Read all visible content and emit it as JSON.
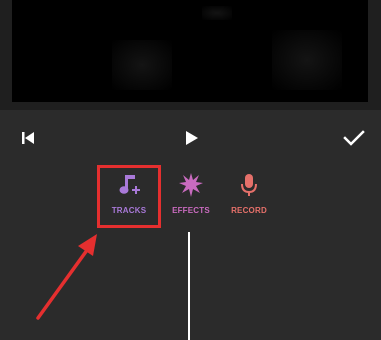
{
  "controls": {
    "skip_back_icon": "skip-to-start-icon",
    "play_icon": "play-icon",
    "done_icon": "checkmark-icon"
  },
  "tabs": [
    {
      "label": "TRACKS",
      "icon": "music-note-plus-icon",
      "color": "#a979d9"
    },
    {
      "label": "EFFECTS",
      "icon": "sparkle-burst-icon",
      "color": "#c96bbf"
    },
    {
      "label": "RECORD",
      "icon": "microphone-icon",
      "color": "#e5706a"
    }
  ],
  "annotation": {
    "highlight_color": "#e52f2f",
    "highlighted_tab": "TRACKS"
  },
  "colors": {
    "background": "#2b2b2b",
    "top_band": "#1f1f1f",
    "preview": "#000000",
    "playhead": "#ffffff"
  }
}
